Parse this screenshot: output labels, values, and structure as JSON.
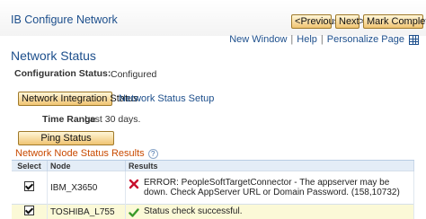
{
  "app": {
    "title": "IB Configure Network"
  },
  "nav": {
    "previous": "Previous",
    "next": "Next",
    "mark_complete": "Mark Complete"
  },
  "toplinks": {
    "new_window": "New Window",
    "help": "Help",
    "personalize": "Personalize Page",
    "separator": "|"
  },
  "page": {
    "title": "Network Status",
    "config_status_label": "Configuration Status:",
    "config_status_value": "Configured",
    "network_integration_status_button": "Network Integration Status",
    "network_status_setup_link": "Network Status Setup",
    "time_range_label": "Time Range",
    "time_range_value": "Last 30 days.",
    "ping_button": "Ping Status"
  },
  "grid": {
    "title": "Network Node Status Results",
    "help": "?",
    "columns": [
      "Select",
      "Node",
      "Results"
    ],
    "rows": [
      {
        "selected": true,
        "node": "IBM_X3650",
        "status": "error",
        "result": "ERROR: PeopleSoftTargetConnector - The appserver may be down.  Check AppServer URL or Domain Password. (158,10732)"
      },
      {
        "selected": true,
        "node": "TOSHIBA_L755",
        "status": "success",
        "result": "Status check successful."
      }
    ]
  },
  "colors": {
    "link": "#1d4f8c",
    "grid_title": "#c94a00",
    "error": "#c8102e",
    "success": "#3a9a2a",
    "highlight_row": "#fbf9d7"
  },
  "icons": {
    "error": "x-icon",
    "success": "check-icon",
    "grid_toggle": "grid-icon"
  }
}
